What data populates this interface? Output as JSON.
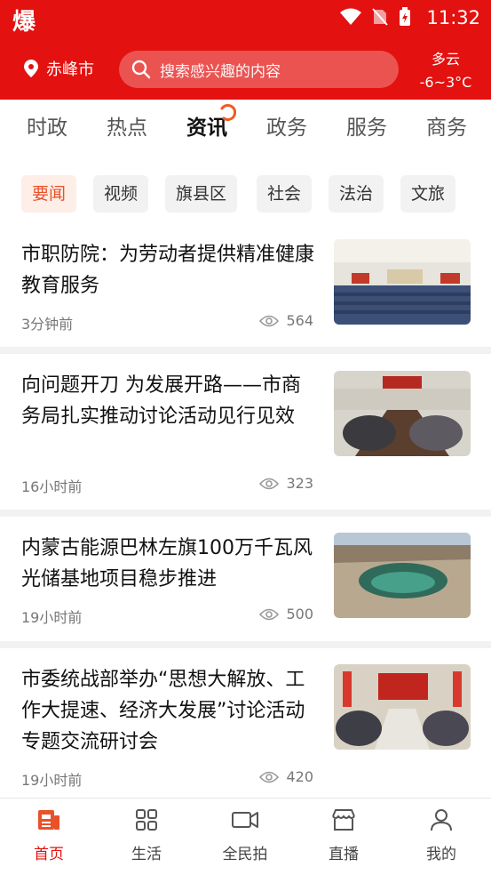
{
  "status": {
    "app_glyph": "爆",
    "time": "11:32"
  },
  "header": {
    "location": "赤峰市",
    "search_placeholder": "搜索感兴趣的内容",
    "weather": "多云",
    "temp": "-6~3°C"
  },
  "tabs": [
    {
      "label": "时政"
    },
    {
      "label": "热点"
    },
    {
      "label": "资讯"
    },
    {
      "label": "政务"
    },
    {
      "label": "服务"
    },
    {
      "label": "商务"
    }
  ],
  "active_tab": "资讯",
  "chips": [
    {
      "label": "要闻"
    },
    {
      "label": "视频"
    },
    {
      "label": "旗县区"
    },
    {
      "label": "社会"
    },
    {
      "label": "法治"
    },
    {
      "label": "文旅"
    }
  ],
  "articles": [
    {
      "title": "市职防院：为劳动者提供精准健康教育服务",
      "time": "3分钟前",
      "views": "564"
    },
    {
      "title": "向问题开刀 为发展开路——市商务局扎实推动讨论活动见行见效",
      "time": "16小时前",
      "views": "323"
    },
    {
      "title": "内蒙古能源巴林左旗100万千瓦风光储基地项目稳步推进",
      "time": "19小时前",
      "views": "500"
    },
    {
      "title": "市委统战部举办“思想大解放、工作大提速、经济大发展”讨论活动专题交流研讨会",
      "time": "19小时前",
      "views": "420"
    }
  ],
  "bottom_nav": [
    {
      "label": "首页"
    },
    {
      "label": "生活"
    },
    {
      "label": "全民拍"
    },
    {
      "label": "直播"
    },
    {
      "label": "我的"
    }
  ],
  "colors": {
    "brand": "#e3110f",
    "chip_active": "#e9522a"
  }
}
